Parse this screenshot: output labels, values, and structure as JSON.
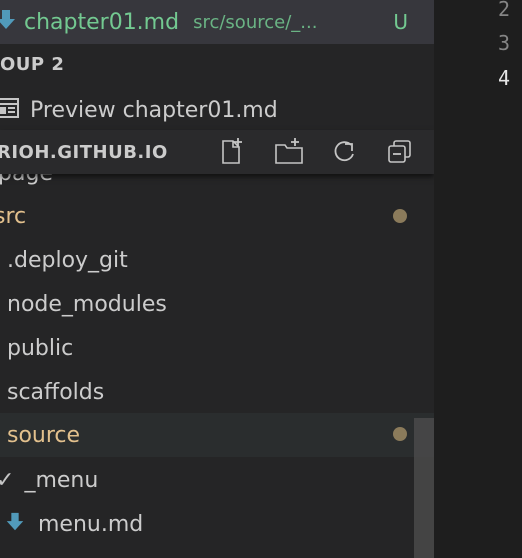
{
  "open_editors": {
    "item1": {
      "name": "chapter01.md",
      "path": "src/source/_...",
      "badge": "U"
    },
    "group_title": "OUP 2",
    "item2": {
      "name": "Preview chapter01.md"
    }
  },
  "explorer": {
    "title": "RIOH.GITHUB.IO",
    "partial_item": "page",
    "items": [
      {
        "label": "src",
        "status": "modified"
      },
      {
        "label": ".deploy_git"
      },
      {
        "label": "node_modules"
      },
      {
        "label": "public"
      },
      {
        "label": "scaffolds"
      },
      {
        "label": "source",
        "status": "modified"
      },
      {
        "label": "_menu",
        "chevron": "✓"
      },
      {
        "label": "menu.md"
      }
    ],
    "actions": [
      "new-file-icon",
      "new-folder-icon",
      "refresh-icon",
      "collapse-all-icon"
    ]
  },
  "editor": {
    "line_numbers": [
      "2",
      "3",
      "4"
    ],
    "active_line": "4"
  },
  "colors": {
    "untracked": "#73c991",
    "modified": "#e2c08d",
    "markdown_icon": "#519aba",
    "sidebar_bg": "#252526",
    "editor_bg": "#1e1e1e"
  }
}
